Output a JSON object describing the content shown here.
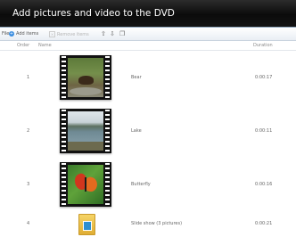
{
  "window": {
    "title": "Add pictures and video to the DVD"
  },
  "toolbar": {
    "file_label": "File",
    "add_items_label": "Add items",
    "remove_items_label": "Remove items",
    "move_up_icon": "arrow-up-icon",
    "move_down_icon": "arrow-down-icon",
    "duplicate_icon": "copy-icon"
  },
  "columns": {
    "order": "Order",
    "name": "Name",
    "duration": "Duration"
  },
  "items": [
    {
      "order": "1",
      "name": "Bear",
      "duration": "0:00:17",
      "thumbnail": "bear-video-thumbnail"
    },
    {
      "order": "2",
      "name": "Lake",
      "duration": "0:00:11",
      "thumbnail": "lake-video-thumbnail"
    },
    {
      "order": "3",
      "name": "Butterfly",
      "duration": "0:00:16",
      "thumbnail": "butterfly-video-thumbnail"
    },
    {
      "order": "4",
      "name": "Slide show (3 pictures)",
      "duration": "0:00:21",
      "thumbnail": "slideshow-folder-icon"
    }
  ],
  "colors": {
    "titlebar": "#111111",
    "accent": "#3a8de0",
    "film": "#111111"
  }
}
